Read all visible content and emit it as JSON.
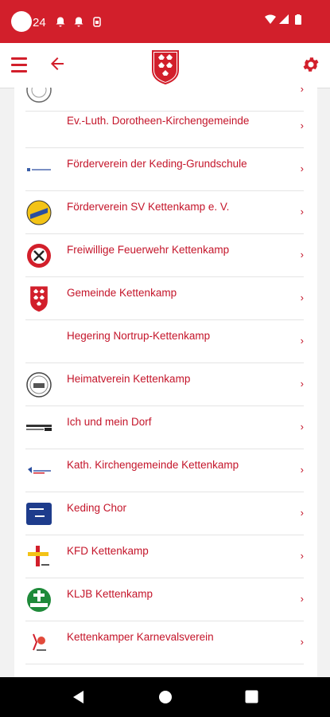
{
  "status_bar": {
    "time": "24",
    "icons": [
      "bell-icon",
      "bell-icon",
      "sim-icon",
      "wifi-icon",
      "signal-icon",
      "battery-icon"
    ]
  },
  "app_bar": {
    "menu_icon": "hamburger-menu-icon",
    "back_icon": "arrow-back-icon",
    "logo": "municipality-crest",
    "settings_icon": "gear-icon",
    "brand_color": "#d21f2b"
  },
  "organizations": [
    {
      "name": "",
      "logo": "round-seal-logo"
    },
    {
      "name": "Ev.-Luth. Dorotheen-Kirchengemeinde",
      "logo": ""
    },
    {
      "name": "Förderverein der Keding-Grundschule",
      "logo": "small-blue-text-logo"
    },
    {
      "name": "Förderverein SV Kettenkamp e. V.",
      "logo": "blue-yellow-badge-logo"
    },
    {
      "name": "Freiwillige Feuerwehr Kettenkamp",
      "logo": "fire-brigade-logo"
    },
    {
      "name": "Gemeinde Kettenkamp",
      "logo": "municipality-crest"
    },
    {
      "name": "Hegering Nortrup-Kettenkamp",
      "logo": ""
    },
    {
      "name": "Heimatverein Kettenkamp",
      "logo": "heritage-seal-logo"
    },
    {
      "name": "Ich und mein Dorf",
      "logo": "wide-text-logo"
    },
    {
      "name": "Kath. Kirchengemeinde Kettenkamp",
      "logo": "parish-logo"
    },
    {
      "name": "Keding Chor",
      "logo": "blue-choir-logo"
    },
    {
      "name": "KFD Kettenkamp",
      "logo": "kfd-cross-logo"
    },
    {
      "name": "KLJB Kettenkamp",
      "logo": "green-kljb-logo"
    },
    {
      "name": "Kettenkamper Karnevalsverein",
      "logo": "carnival-logo"
    },
    {
      "name": "",
      "logo": "partial-logo"
    }
  ],
  "chevron": "›",
  "nav_bar": {
    "icons": [
      "back-triangle-icon",
      "home-circle-icon",
      "recents-square-icon"
    ]
  }
}
